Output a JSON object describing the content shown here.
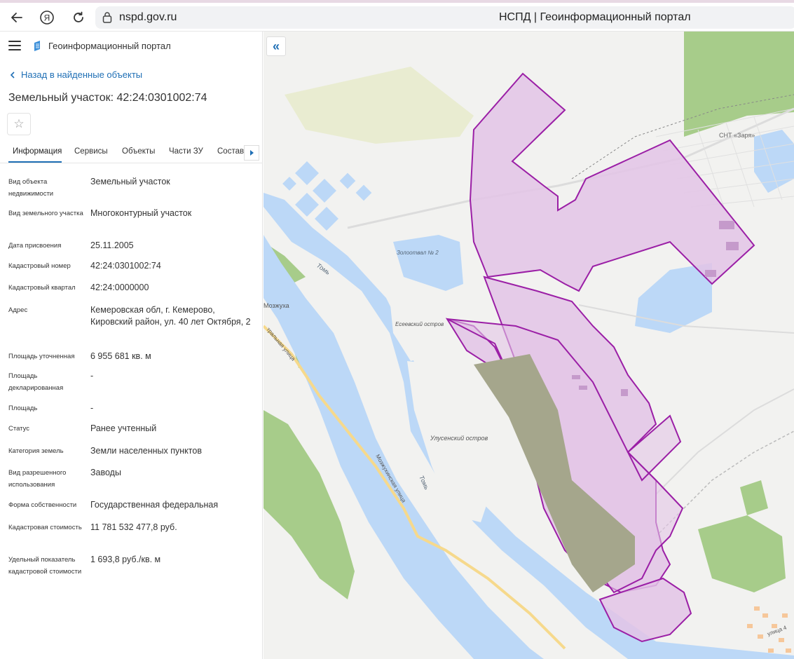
{
  "browser": {
    "url": "nspd.gov.ru",
    "page_title": "НСПД | Геоинформационный портал"
  },
  "header": {
    "portal_name": "Геоинформационный портал"
  },
  "back_link": "Назад в найденные объекты",
  "object_title": "Земельный участок: 42:24:0301002:74",
  "tabs": [
    {
      "label": "Информация"
    },
    {
      "label": "Сервисы"
    },
    {
      "label": "Объекты"
    },
    {
      "label": "Части ЗУ"
    },
    {
      "label": "Состав"
    }
  ],
  "fields": [
    {
      "label": "Вид объекта недвижимости",
      "value": "Земельный участок"
    },
    {
      "label": "Вид земельного участка",
      "value": "Многоконтурный участок"
    },
    {
      "label": "Дата присвоения",
      "value": "25.11.2005"
    },
    {
      "label": "Кадастровый номер",
      "value": "42:24:0301002:74"
    },
    {
      "label": "Кадастровый квартал",
      "value": "42:24:0000000"
    },
    {
      "label": "Адрес",
      "value": "Кемеровская обл, г. Кемерово, Кировский район, ул. 40 лет Октября, 2"
    },
    {
      "label": "Площадь уточненная",
      "value": "6 955 681 кв. м"
    },
    {
      "label": "Площадь декларированная",
      "value": "-"
    },
    {
      "label": "Площадь",
      "value": "-"
    },
    {
      "label": "Статус",
      "value": "Ранее учтенный"
    },
    {
      "label": "Категория земель",
      "value": "Земли населенных пунктов"
    },
    {
      "label": "Вид разрешенного использования",
      "value": "Заводы"
    },
    {
      "label": "Форма собственности",
      "value": "Государственная федеральная"
    },
    {
      "label": "Кадастровая стоимость",
      "value": "11 781 532 477,8 руб."
    },
    {
      "label": "Удельный показатель кадастровой стоимости",
      "value": "1 693,8 руб./кв. м"
    }
  ],
  "map": {
    "labels": {
      "snt": "СНТ «Заря»",
      "ash": "Золоотвал № 2",
      "tom1": "Томь",
      "tom2": "Томь",
      "eseev": "Есеевский остров",
      "ulus": "Улусенский остров",
      "mozh": "Мозжуха",
      "central": "тральная улица",
      "mozhstreet": "Мозжухинская улица",
      "ulitsa": "улица 4"
    }
  },
  "colors": {
    "accent": "#1f6fb5",
    "parcel_fill": "#e3c4e6",
    "parcel_stroke": "#9b1fa6",
    "water": "#bcd8f7",
    "forest": "#a7cc8a"
  }
}
